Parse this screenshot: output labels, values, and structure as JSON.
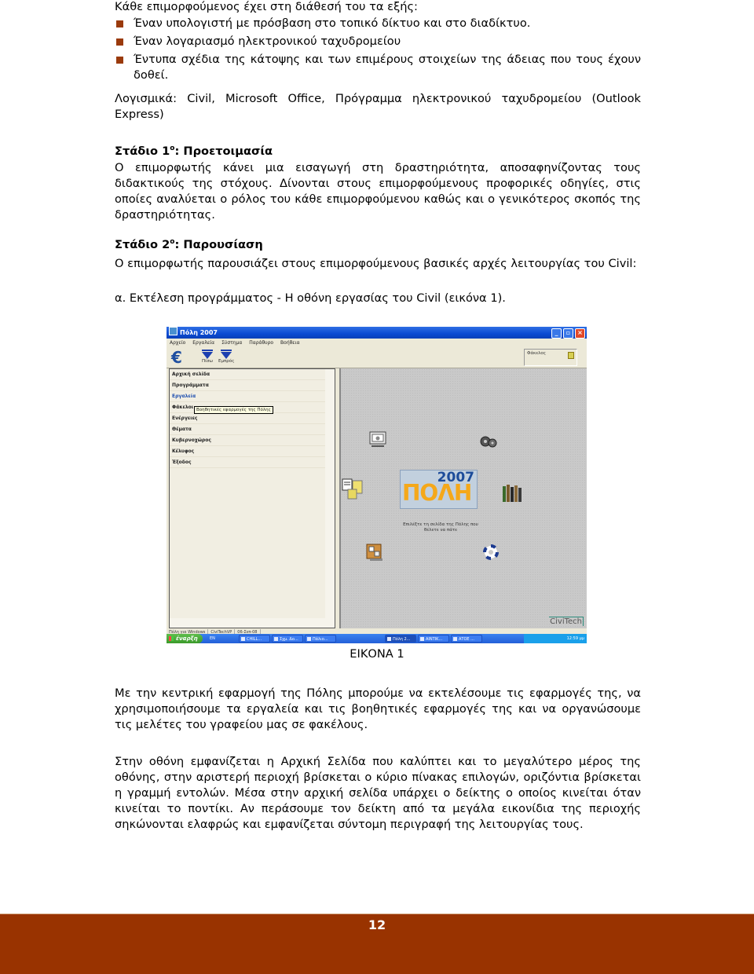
{
  "intro": {
    "lead": "Κάθε επιμορφούμενος έχει στη διάθεσή του τα εξής:",
    "bullets": [
      "Έναν υπολογιστή με πρόσβαση στο τοπικό δίκτυο και στο διαδίκτυο.",
      "Έναν λογαριασμό ηλεκτρονικού ταχυδρομείου",
      "Έντυπα σχέδια της κάτοψης και των επιμέρους στοιχείων της άδειας που τους έχουν δοθεί."
    ],
    "software": "Λογισμικά: Civil, Microsoft Office, Πρόγραμμα ηλεκτρονικού ταχυδρομείου (Outlook Express)"
  },
  "stage1": {
    "heading_prefix": "Στάδιο 1",
    "heading_sup": "ο",
    "heading_suffix": ":  Προετοιμασία",
    "body": "Ο επιμορφωτής κάνει μια εισαγωγή στη δραστηριότητα, αποσαφηνίζοντας τους διδακτικούς της στόχους. Δίνονται στους επιμορφούμενους προφορικές οδηγίες, στις οποίες αναλύεται ο ρόλος του κάθε επιμορφούμενου καθώς και ο γενικότερος σκοπός της δραστηριότητας."
  },
  "stage2": {
    "heading_prefix": "Στάδιο 2",
    "heading_sup": "ο",
    "heading_suffix": ":  Παρουσίαση",
    "body": "Ο επιμορφωτής παρουσιάζει στους επιμορφούμενους βασικές αρχές λειτουργίας του Civil:",
    "item_a": "α. Εκτέλεση προγράμματος - Η οθόνη εργασίας του Civil (εικόνα 1)."
  },
  "screenshot": {
    "window_title": "Πόλη 2007",
    "menu": [
      "Αρχείο",
      "Εργαλεία",
      "Σύστημα",
      "Παράθυρο",
      "Βοήθεια"
    ],
    "toolbar": {
      "back": "Πίσω",
      "forward": "Εμπρός",
      "folder_label": "Φάκελος"
    },
    "sidebar": [
      {
        "label": "Αρχική σελίδα",
        "arrow": ""
      },
      {
        "label": "Προγράμματα",
        "arrow": ""
      },
      {
        "label": "Εργαλεία",
        "arrow": ""
      },
      {
        "label": "Φάκελοι",
        "arrow": "▸"
      },
      {
        "label": "Ενέργειες",
        "arrow": "▸"
      },
      {
        "label": "Θέματα",
        "arrow": ""
      },
      {
        "label": "Κυβερνοχώρος",
        "arrow": "▸"
      },
      {
        "label": "Κέλυφος",
        "arrow": "▸"
      },
      {
        "label": "Έξοδος",
        "arrow": ""
      }
    ],
    "tooltip": "Βοηθητικές εφαρμογές της Πόλης",
    "logo": {
      "name": "ΠΟΛΗ",
      "year": "2007"
    },
    "logo_caption": "Επιλέξτε τη σελίδα της Πόλης που θέλετε να πάτε",
    "brand": "CiviTech",
    "statusbar": [
      "Πόλη για Windows",
      "CiviTechVP",
      "06-Σεπ-08"
    ],
    "taskbar": {
      "start": "έναρξη",
      "lang": "EN",
      "tasks": [
        "CHILL...",
        "Σχμ. Δο...",
        "Πάλιο...",
        "Πόλη 2...",
        "AINTIK...",
        "ΑΤΟΕ ..."
      ],
      "active_task": 3,
      "clock": "12:59 μμ"
    }
  },
  "figure_caption": "ΕΙΚΟΝΑ 1",
  "para1": "Με την κεντρική εφαρμογή της Πόλης μπορούμε να εκτελέσουμε τις εφαρμογές της, να χρησιμοποιήσουμε τα εργαλεία και τις βοηθητικές εφαρμογές της και να οργανώσουμε τις μελέτες του γραφείου μας σε φακέλους.",
  "para2": "Στην οθόνη εμφανίζεται η Αρχική Σελίδα που καλύπτει και το μεγαλύτερο μέρος της οθόνης, στην αριστερή περιοχή βρίσκεται ο κύριο πίνακας επιλογών, οριζόντια βρίσκεται η γραμμή εντολών. Μέσα στην αρχική σελίδα υπάρχει ο δείκτης ο οποίος κινείται όταν κινείται το ποντίκι. Αν περάσουμε τον δείκτη από τα μεγάλα εικονίδια της περιοχής  σηκώνονται ελαφρώς και εμφανίζεται σύντομη περιγραφή της λειτουργίας τους.",
  "footer": {
    "page_number": "12",
    "color": "#993300"
  }
}
